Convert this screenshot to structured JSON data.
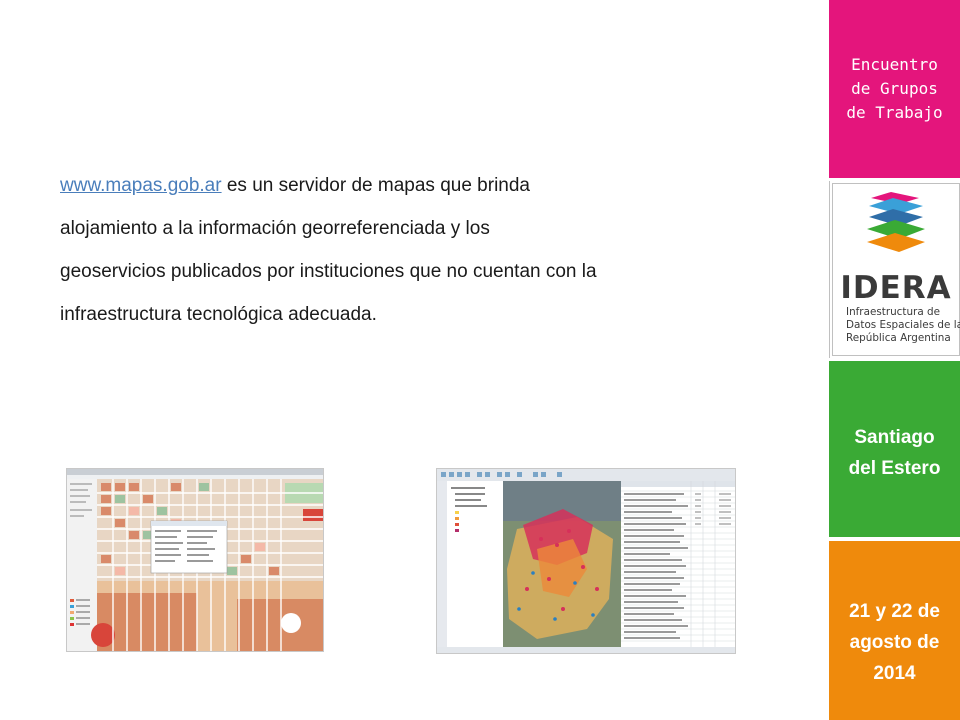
{
  "body": {
    "link": "www.mapas.gob.ar",
    "text": " es un servidor de mapas que brinda alojamiento a la información georreferenciada y los geoservicios publicados por instituciones que no cuentan con la infraestructura tecnológica adecuada."
  },
  "rail": {
    "event_lines": [
      "Encuentro",
      "de Grupos",
      "de Trabajo"
    ],
    "logo": {
      "name": "IDERA",
      "sub_lines": [
        "Infraestructura de",
        "Datos Espaciales de la",
        "República Argentina"
      ]
    },
    "place_lines": [
      "Santiago",
      "del Estero"
    ],
    "date_lines": [
      "21 y 22 de",
      "agosto de",
      "2014"
    ]
  },
  "colors": {
    "pink": "#e4157c",
    "green": "#3aaa35",
    "orange": "#ef8a0c",
    "link": "#4a7ebb"
  }
}
